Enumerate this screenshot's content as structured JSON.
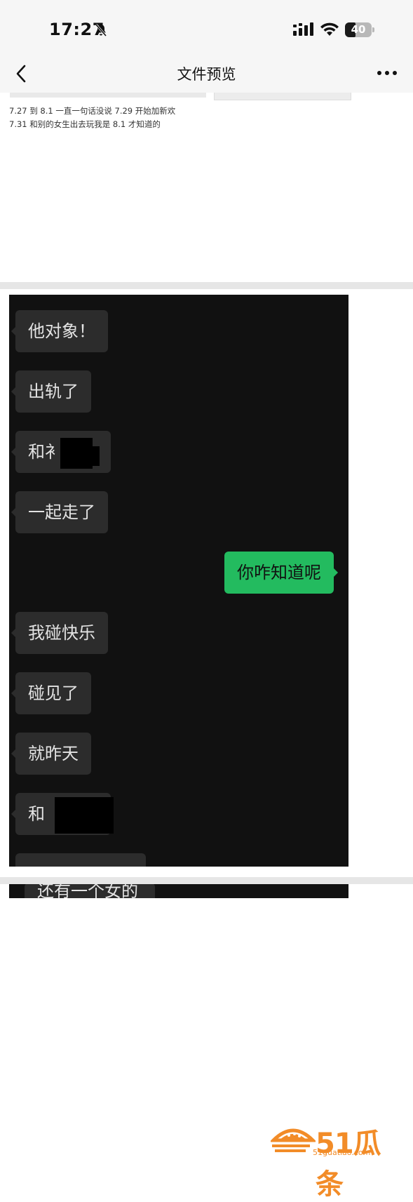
{
  "status_bar": {
    "time": "17:27",
    "battery": "40",
    "battery_level": 0.4,
    "icons": [
      "bell-slash-icon",
      "signal-icon",
      "wifi-icon",
      "battery-icon"
    ]
  },
  "nav": {
    "title": "文件预览",
    "back_icon": "chevron-left-icon",
    "more_icon": "more-dots-icon"
  },
  "page1": {
    "lines": [
      "7.27 到 8.1 一直一句话没说 7.29 开始加新欢",
      "7.31 和别的女生出去玩我是 8.1 才知道的"
    ]
  },
  "chat": {
    "messages": [
      {
        "side": "in",
        "text": "他对象！"
      },
      {
        "side": "in",
        "text": "出轨了"
      },
      {
        "side": "in",
        "text": "和衤"
      },
      {
        "side": "in",
        "text": "一起走了"
      },
      {
        "side": "out",
        "text": "你咋知道呢"
      },
      {
        "side": "in",
        "text": "我碰快乐"
      },
      {
        "side": "in",
        "text": "碰见了"
      },
      {
        "side": "in",
        "text": "就昨天"
      },
      {
        "side": "in",
        "text": "和"
      }
    ],
    "next_page_message": "还有一个女的"
  },
  "watermark": {
    "brand": "51瓜条",
    "url": "51guatiao.com"
  },
  "colors": {
    "accent_green": "#23bb5f",
    "chat_background": "#111111",
    "incoming_bubble": "#2c2c2c",
    "watermark_orange": "#f28c28"
  }
}
